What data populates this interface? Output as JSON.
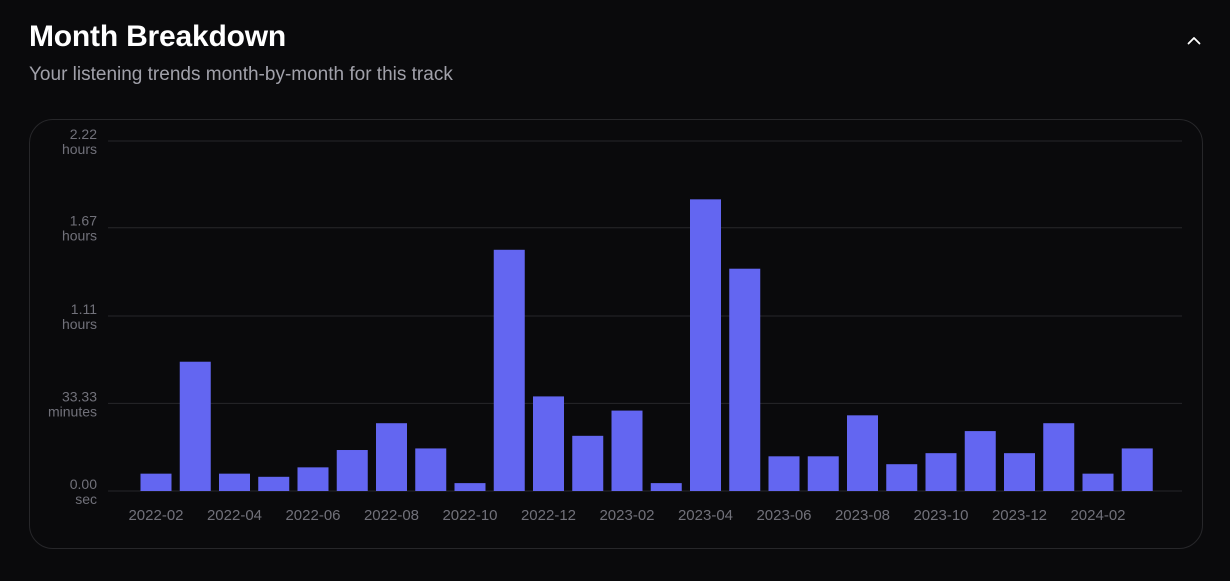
{
  "header": {
    "title": "Month Breakdown",
    "subtitle": "Your listening trends month-by-month for this track",
    "collapse_icon": "chevron-up-icon"
  },
  "colors": {
    "bar": "#6366f1",
    "grid": "#27272a",
    "text_muted": "#71717a"
  },
  "chart_data": {
    "type": "bar",
    "title": "",
    "xlabel": "",
    "ylabel": "",
    "y_unit": "hours",
    "ylim": [
      0,
      2.22
    ],
    "grid": true,
    "y_ticks": [
      {
        "value": 0,
        "line1": "0.00",
        "line2": "sec"
      },
      {
        "value": 0.5556,
        "line1": "33.33",
        "line2": "minutes"
      },
      {
        "value": 1.11,
        "line1": "1.11",
        "line2": "hours"
      },
      {
        "value": 1.67,
        "line1": "1.67",
        "line2": "hours"
      },
      {
        "value": 2.22,
        "line1": "2.22",
        "line2": "hours"
      }
    ],
    "categories": [
      "2022-02",
      "2022-03",
      "2022-04",
      "2022-05",
      "2022-06",
      "2022-07",
      "2022-08",
      "2022-09",
      "2022-10",
      "2022-11",
      "2022-12",
      "2023-01",
      "2023-02",
      "2023-03",
      "2023-04",
      "2023-05",
      "2023-06",
      "2023-07",
      "2023-08",
      "2023-09",
      "2023-10",
      "2023-11",
      "2023-12",
      "2024-01",
      "2024-02",
      "2024-03"
    ],
    "x_tick_labels": [
      "2022-02",
      "2022-04",
      "2022-06",
      "2022-08",
      "2022-10",
      "2022-12",
      "2023-02",
      "2023-04",
      "2023-06",
      "2023-08",
      "2023-10",
      "2023-12",
      "2024-02"
    ],
    "values": [
      0.11,
      0.82,
      0.11,
      0.09,
      0.15,
      0.26,
      0.43,
      0.27,
      0.05,
      1.53,
      0.6,
      0.35,
      0.51,
      0.05,
      1.85,
      1.41,
      0.22,
      0.22,
      0.48,
      0.17,
      0.24,
      0.38,
      0.24,
      0.43,
      0.11,
      0.27
    ]
  }
}
